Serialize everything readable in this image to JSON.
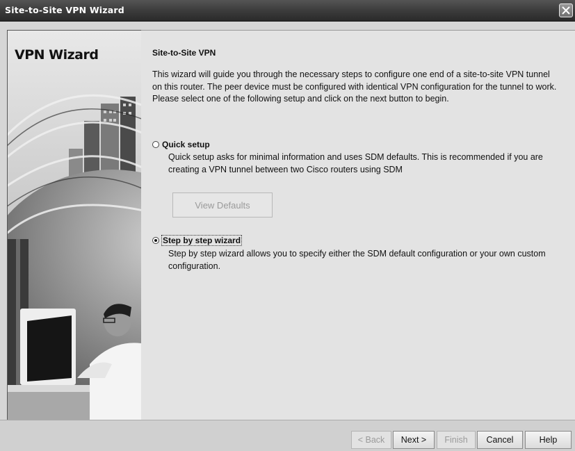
{
  "window": {
    "title": "Site-to-Site VPN Wizard"
  },
  "sidebar": {
    "title": "VPN Wizard",
    "illustration": "network-person-computer-illustration"
  },
  "main": {
    "heading": "Site-to-Site VPN",
    "intro": "This wizard will guide you through the necessary steps to configure one end of a site-to-site VPN tunnel on this router. The peer device must be configured with identical VPN configuration for the tunnel to work. Please select one of the following setup and click on the next button to begin.",
    "options": [
      {
        "label": "Quick setup",
        "description": "Quick setup asks for minimal information and uses SDM defaults. This is recommended if you are creating a VPN tunnel between two Cisco routers using SDM",
        "selected": false
      },
      {
        "label": "Step by step wizard",
        "description": "Step by step wizard allows you to specify either the SDM default configuration or your own custom configuration.",
        "selected": true
      }
    ],
    "view_defaults_label": "View Defaults"
  },
  "footer": {
    "back_label": "< Back",
    "next_label": "Next >",
    "finish_label": "Finish",
    "cancel_label": "Cancel",
    "help_label": "Help"
  },
  "icons": {
    "close": "close-icon"
  }
}
